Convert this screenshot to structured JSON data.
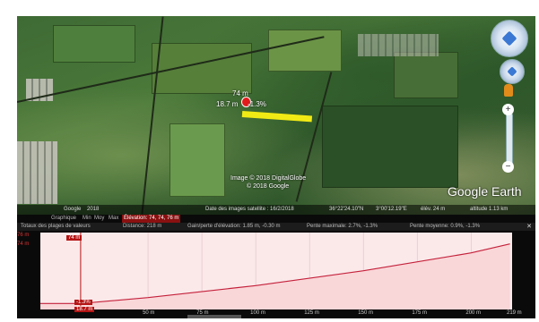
{
  "map": {
    "line_elevation": "74 m",
    "line_distance": "18.7 m",
    "line_grade": "-1.3%",
    "credit_line1": "Image © 2018 DigitalGlobe",
    "credit_line2": "© 2018 Google",
    "logo": "Google Earth",
    "line_color": "#f2ea14"
  },
  "status_bar": {
    "logo_text": "Google",
    "year": "2018",
    "image_date": "Date des images satellite : 16/2/2018",
    "lat": "36°22'24.10\"N",
    "lon": "3°00'12.19\"E",
    "elev": "élév.   24 m",
    "altitude": "altitude  1.13 km"
  },
  "profile_toolbar": {
    "graph_label": "Graphique",
    "min_label": "Min",
    "avg_label": "Moy",
    "max_label": "Max",
    "elevation_selected": "Élévation: 74, 74, 76 m",
    "totals_label": "Totaux des plages de valeurs",
    "distance": "Distance: 218 m",
    "gain_loss": "Gain/perte d'élévation: 1.85 m, -0.30 m",
    "max_slope": "Pente maximale: 2.7%, -1.3%",
    "avg_slope": "Pente moyenne: 0.9%, -1.3%",
    "close_icon": "close-icon"
  },
  "chart_data": {
    "type": "area",
    "x": [
      0,
      18.7,
      50,
      100,
      150,
      200,
      218
    ],
    "values": [
      74,
      74,
      74.2,
      74.6,
      75.1,
      75.7,
      76
    ],
    "xlabel": "",
    "ylabel": "",
    "y_ticks": [
      "76 m",
      "74 m"
    ],
    "x_ticks": [
      "50 m",
      "75 m",
      "100 m",
      "125 m",
      "150 m",
      "175 m",
      "200 m",
      "219 m"
    ],
    "ylim": [
      73.8,
      76.2
    ],
    "xlim": [
      0,
      219
    ],
    "fill_color": "#f9d6d8",
    "line_color": "#c4213a",
    "cursor": {
      "x": 18.7,
      "elevation": "74 m",
      "grade": "-1.3%",
      "distance": "18.7 m"
    }
  }
}
